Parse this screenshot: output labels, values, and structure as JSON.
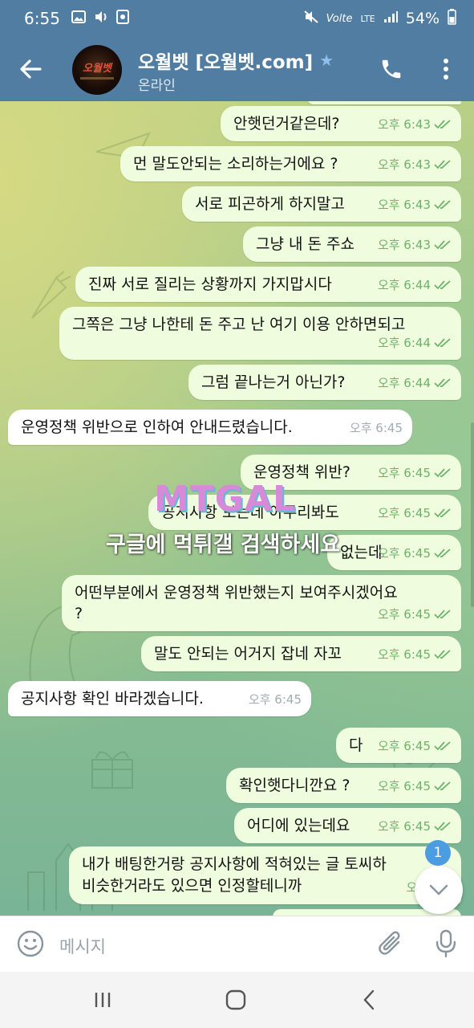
{
  "status_bar": {
    "time": "6:55",
    "network": "LTE",
    "carrier_label": "Volte",
    "battery": "54%"
  },
  "header": {
    "title": "오월벳 [오월벳.com]",
    "status": "온라인"
  },
  "messages": [
    {
      "dir": "out",
      "text": "안햇던거같은데?",
      "time": "오후 6:43"
    },
    {
      "dir": "out",
      "text": "먼 말도안되는 소리하는거에요 ?",
      "time": "오후 6:43"
    },
    {
      "dir": "out",
      "text": "서로 피곤하게 하지말고",
      "time": "오후 6:43"
    },
    {
      "dir": "out",
      "text": "그냥 내 돈 주쇼",
      "time": "오후 6:43"
    },
    {
      "dir": "out",
      "text": "진짜 서로 질리는 상황까지 가지맙시다",
      "time": "오후 6:44"
    },
    {
      "dir": "out",
      "text": "그쪽은 그냥 나한테 돈 주고 난 여기 이용 안하면되고",
      "time": "오후 6:44"
    },
    {
      "dir": "out",
      "text": "그럼 끝나는거 아닌가?",
      "time": "오후 6:44"
    },
    {
      "dir": "in",
      "text": "운영정책 위반으로 인하여 안내드렸습니다.",
      "time": "오후 6:45"
    },
    {
      "dir": "out",
      "text": "운영정책 위반?",
      "time": "오후 6:45"
    },
    {
      "dir": "out",
      "text": "공지사항 보는데 아무리봐도",
      "time": "오후 6:45"
    },
    {
      "dir": "out",
      "text": "없는데",
      "time": "오후 6:45"
    },
    {
      "dir": "out",
      "text": "어떤부분에서 운영정책 위반했는지 보여주시겠어요",
      "text2": "?",
      "time": "오후 6:45"
    },
    {
      "dir": "out",
      "text": "말도 안되는 어거지 잡네 자꼬",
      "time": "오후 6:45"
    },
    {
      "dir": "in",
      "text": "공지사항 확인 바라겠습니다.",
      "time": "오후 6:45"
    },
    {
      "dir": "out",
      "text": "다",
      "time": "오후 6:45"
    },
    {
      "dir": "out",
      "text": "확인햇다니깐요 ?",
      "time": "오후 6:45"
    },
    {
      "dir": "out",
      "text": "어디에 있는데요",
      "time": "오후 6:45"
    },
    {
      "dir": "out",
      "text": "내가 배팅한거랑 공지사항에 적혀있는 글 토씨하",
      "text2": "비슷한거라도 있으면 인정할테니까",
      "time": "오후 6:4"
    }
  ],
  "watermark": {
    "logo": "MTGAL",
    "text": "구글에 먹튀갤 검색하세요"
  },
  "scroll_badge": "1",
  "input": {
    "placeholder": "메시지"
  },
  "icons": {
    "back": "arrow-left-icon",
    "call": "phone-icon",
    "menu": "more-vert-icon",
    "emoji": "emoji-icon",
    "attach": "paperclip-icon",
    "mic": "microphone-icon",
    "scroll_down": "chevron-down-icon"
  },
  "colors": {
    "header": "#517da2",
    "outgoing_bubble": "#effdde",
    "incoming_bubble": "#ffffff",
    "read_ticks": "#6cb36a",
    "badge": "#4c9ce2"
  }
}
